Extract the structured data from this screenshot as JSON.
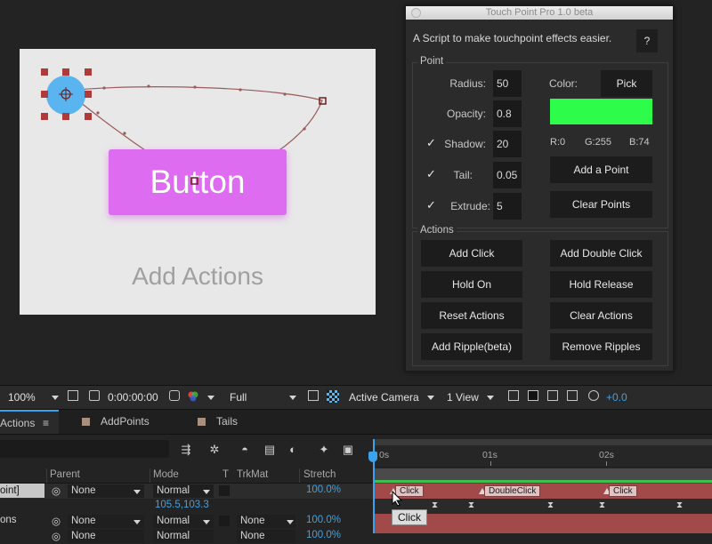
{
  "composition": {
    "button_text": "Button",
    "caption": "Add Actions",
    "colors": {
      "background": "#e8e8e8",
      "button": "#dd6cf0",
      "touch_point": "#5ab4f0",
      "path": "#9a5a5a"
    }
  },
  "panel": {
    "title": "Touch Point Pro 1.0 beta",
    "description": "A Script to make touchpoint effects easier.",
    "help_label": "?",
    "point_group": {
      "title": "Point",
      "radius_label": "Radius:",
      "radius_value": "50",
      "opacity_label": "Opacity:",
      "opacity_value": "0.8",
      "shadow_label": "Shadow:",
      "shadow_value": "20",
      "tail_label": "Tail:",
      "tail_value": "0.05",
      "extrude_label": "Extrude:",
      "extrude_value": "5",
      "check_mark": "✓",
      "color_label": "Color:",
      "pick_label": "Pick",
      "swatch_color": "#2efc4a",
      "r_text": "R:0",
      "g_text": "G:255",
      "b_text": "B:74",
      "add_point_label": "Add a Point",
      "clear_points_label": "Clear Points"
    },
    "actions_group": {
      "title": "Actions",
      "buttons": [
        "Add Click",
        "Add Double Click",
        "Hold On",
        "Hold Release",
        "Reset Actions",
        "Clear Actions",
        "Add Ripple(beta)",
        "Remove Ripples"
      ]
    }
  },
  "toolbar": {
    "zoom": "100%",
    "timecode": "0:00:00:00",
    "resolution": "Full",
    "camera": "Active Camera",
    "view": "1 View",
    "exposure": "+0.0"
  },
  "tabs": [
    {
      "label": "Actions",
      "menu": "≡"
    },
    {
      "label": "AddPoints"
    },
    {
      "label": "Tails"
    }
  ],
  "columns": {
    "parent": "Parent",
    "mode": "Mode",
    "t": "T",
    "trkmat": "TrkMat",
    "stretch": "Stretch"
  },
  "layers": [
    {
      "name": "oint]",
      "parent": "None",
      "mode": "Normal",
      "trkmat": "",
      "stretch": "100.0%"
    },
    {
      "name": "",
      "parent": "",
      "mode": "",
      "trkmat": "",
      "stretch": "",
      "value": "105.5,103.3"
    },
    {
      "name": "ons",
      "parent": "None",
      "mode": "Normal",
      "trkmat": "None",
      "stretch": "100.0%"
    },
    {
      "name": "",
      "parent": "None",
      "mode": "Normal",
      "trkmat": "None",
      "stretch": "100.0%"
    }
  ],
  "ruler": {
    "labels": [
      "0s",
      "01s",
      "02s"
    ]
  },
  "keyframes": {
    "labels": [
      "Click",
      "DoubleClick",
      "Click"
    ],
    "tooltip": "Click"
  }
}
